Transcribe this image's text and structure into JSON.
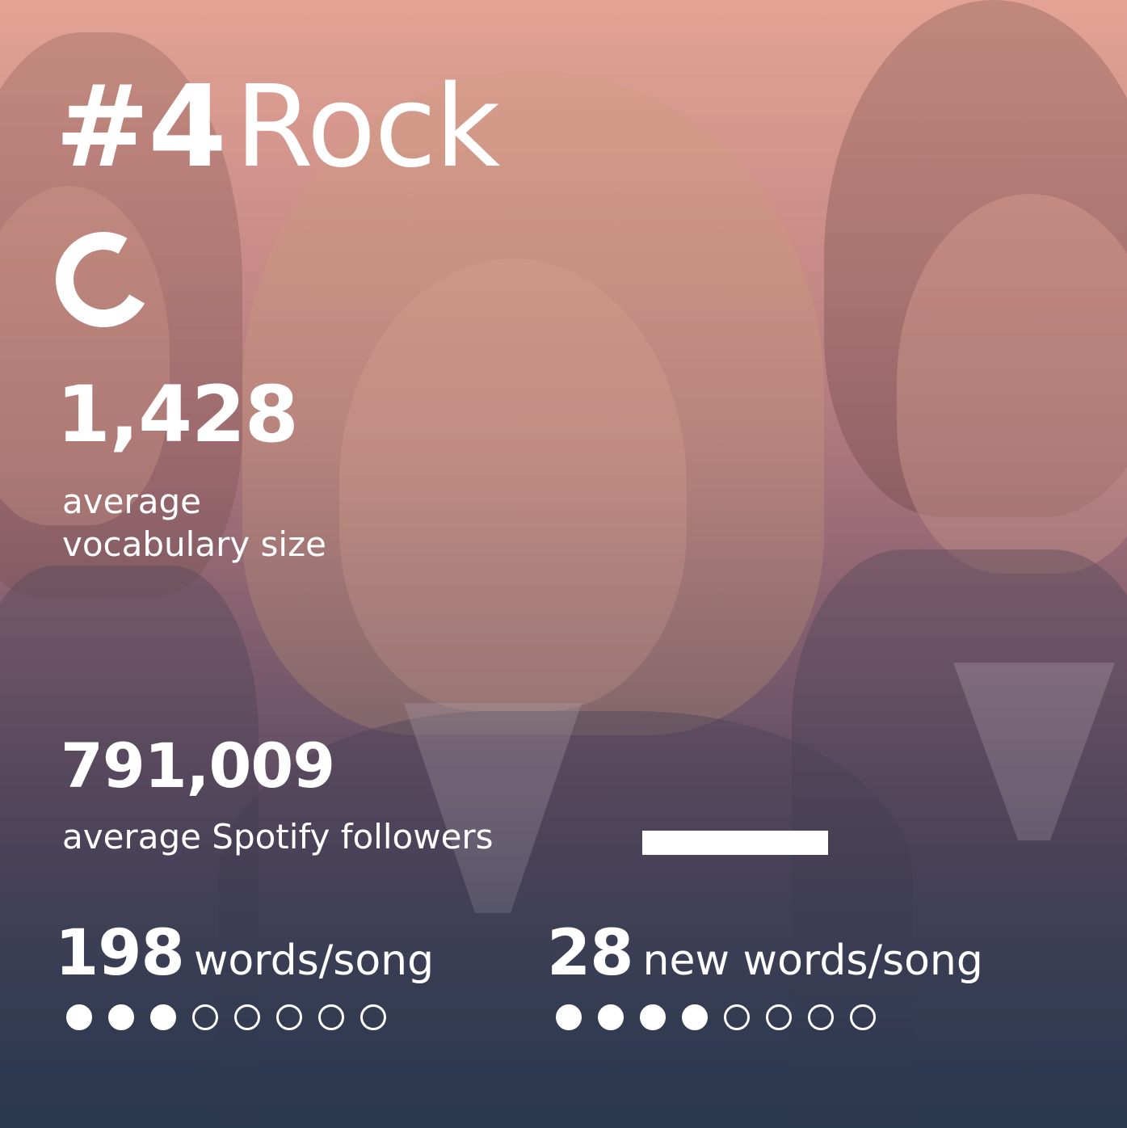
{
  "rank": "#4",
  "genre": "Rock",
  "vocabulary": {
    "value": "1,428",
    "label_line1": "average",
    "label_line2": "vocabulary size"
  },
  "followers": {
    "value": "791,009",
    "label": "average Spotify followers"
  },
  "words_per_song": {
    "value": "198",
    "unit": "words/song",
    "rating_filled": 3,
    "rating_total": 8
  },
  "new_words_per_song": {
    "value": "28",
    "unit": "new words/song",
    "rating_filled": 4,
    "rating_total": 8
  },
  "colors": {
    "text": "#ffffff",
    "gradient_top": "#e3a796",
    "gradient_bottom": "#2c3b52"
  },
  "icons": [
    "progress-ring-icon"
  ]
}
